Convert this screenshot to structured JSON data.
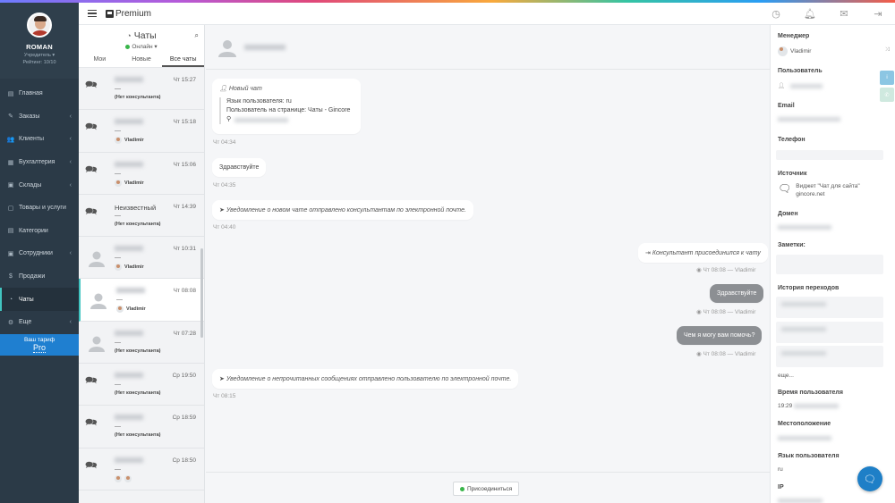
{
  "user": {
    "name": "ROMAN",
    "role": "Учредитель ▾",
    "rating": "Рейтинг: 10/10"
  },
  "nav": [
    {
      "label": "Главная",
      "icon": "▤",
      "chev": ""
    },
    {
      "label": "Заказы",
      "icon": "✎",
      "chev": "‹"
    },
    {
      "label": "Клиенты",
      "icon": "👥",
      "chev": "‹"
    },
    {
      "label": "Бухгалтерия",
      "icon": "▦",
      "chev": "‹"
    },
    {
      "label": "Склады",
      "icon": "▣",
      "chev": "‹"
    },
    {
      "label": "Товары и услуги",
      "icon": "▢",
      "chev": ""
    },
    {
      "label": "Категории",
      "icon": "▤",
      "chev": ""
    },
    {
      "label": "Сотрудники",
      "icon": "▣",
      "chev": "‹"
    },
    {
      "label": "Продажи",
      "icon": "$",
      "chev": ""
    },
    {
      "label": "Чаты",
      "icon": "◔",
      "chev": ""
    },
    {
      "label": "Еще",
      "icon": "⚙",
      "chev": "‹"
    }
  ],
  "tariff": {
    "label": "Ваш тариф",
    "plan": "Pro"
  },
  "header": {
    "brand": "Premium"
  },
  "chatlist": {
    "title": "Чаты",
    "status": "Онлайн",
    "tabs": [
      "Мои",
      "Новые",
      "Все чаты"
    ],
    "items": [
      {
        "name": "",
        "time": "Чт 15:27",
        "dash": "—",
        "assign": "(Нет консультанта)",
        "type": "icon"
      },
      {
        "name": "",
        "time": "Чт 15:18",
        "dash": "—",
        "assign": "Vladimir",
        "type": "icon"
      },
      {
        "name": "",
        "time": "Чт 15:06",
        "dash": "—",
        "assign": "Vladimir",
        "type": "icon"
      },
      {
        "name": "Неизвестный",
        "time": "Чт 14:39",
        "dash": "—",
        "assign": "(Нет консультанта)",
        "type": "icon"
      },
      {
        "name": "",
        "time": "Чт 10:31",
        "dash": "—",
        "assign": "Vladimir",
        "type": "avatar"
      },
      {
        "name": "",
        "time": "Чт 08:08",
        "dash": "—",
        "assign": "Vladimir",
        "type": "avatar"
      },
      {
        "name": "",
        "time": "Чт 07:28",
        "dash": "—",
        "assign": "(Нет консультанта)",
        "type": "avatar"
      },
      {
        "name": "",
        "time": "Ср 19:50",
        "dash": "—",
        "assign": "(Нет консультанта)",
        "type": "icon"
      },
      {
        "name": "",
        "time": "Ср 18:59",
        "dash": "—",
        "assign": "(Нет консультанта)",
        "type": "icon"
      },
      {
        "name": "",
        "time": "Ср 18:50",
        "dash": "—",
        "assign": "",
        "type": "icon"
      }
    ]
  },
  "chat": {
    "new_chat": "Новый чат",
    "lang_line": "Язык пользователя: ru",
    "page_line": "Пользователь на странице: Чаты - Gincore",
    "t1": "Чт 04:34",
    "hello_user": "Здравствуйте",
    "t2": "Чт 04:35",
    "email_notice": "Уведомление о новом чате отправлено консультантам по электронной почте.",
    "t3": "Чт 04:40",
    "joined": "Консультант присоединился к чату",
    "t4": "Чт 08:08 — Vladimir",
    "hello_op": "Здравствуйте",
    "t5": "Чт 08:08 — Vladimir",
    "help": "Чем я могу вам помочь?",
    "t6": "Чт 08:08 — Vladimir",
    "unread_notice": "Уведомление о непрочитанных сообщениях отправлено пользователю по электронной почте.",
    "t7": "Чт 08:15",
    "join_btn": "Присоединиться"
  },
  "panel": {
    "manager_label": "Менеджер",
    "manager": "Vladimir",
    "user_label": "Пользователь",
    "email_label": "Email",
    "phone_label": "Телефон",
    "source_label": "Источник",
    "source_line1": "Виджет \"Чат для сайта\"",
    "source_line2": "gincore.net",
    "domain_label": "Домен",
    "notes_label": "Заметки:",
    "history_label": "История переходов",
    "more": "еще...",
    "time_label": "Время пользователя",
    "time_val": "19:29",
    "location_label": "Местоположение",
    "lang_label": "Язык пользователя",
    "lang_val": "ru",
    "ip_label": "IP"
  }
}
